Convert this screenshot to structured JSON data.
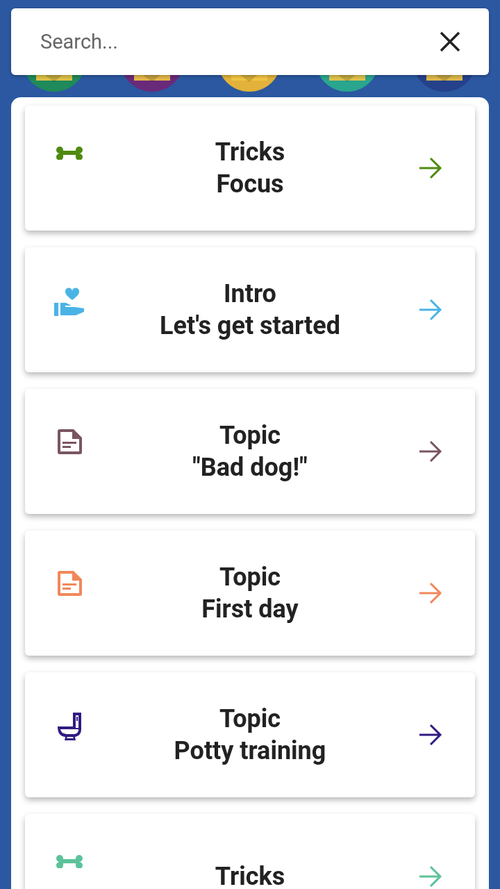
{
  "search": {
    "placeholder": "Search..."
  },
  "categories": [
    {
      "color": "#1f8a5a"
    },
    {
      "color": "#6a2a7a"
    },
    {
      "color": "#e2b23a"
    },
    {
      "color": "#2aa58e"
    },
    {
      "color": "#25418a"
    }
  ],
  "cards": [
    {
      "kind": "bone",
      "color": "#4f8a10",
      "title": "Tricks",
      "subtitle": "Focus"
    },
    {
      "kind": "hand-heart",
      "color": "#4ab3e6",
      "title": "Intro",
      "subtitle": "Let's get started"
    },
    {
      "kind": "document",
      "color": "#7a5560",
      "title": "Topic",
      "subtitle": "\"Bad dog!\""
    },
    {
      "kind": "document",
      "color": "#f0885a",
      "title": "Topic",
      "subtitle": "First day"
    },
    {
      "kind": "toilet",
      "color": "#311b82",
      "title": "Topic",
      "subtitle": "Potty training"
    },
    {
      "kind": "bone",
      "color": "#5cc29a",
      "title": "Tricks"
    }
  ]
}
